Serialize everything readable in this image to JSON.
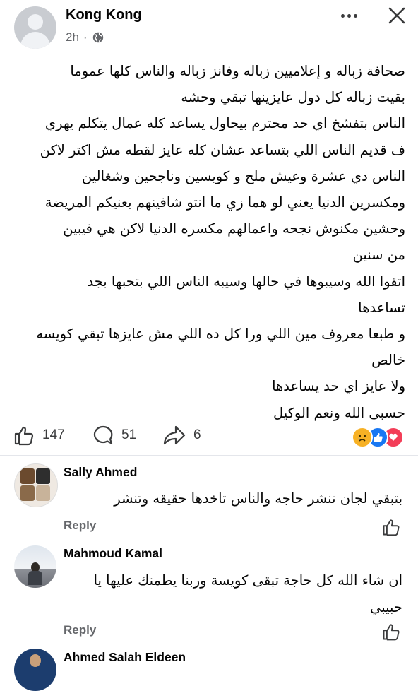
{
  "post": {
    "author": "Kong Kong",
    "time": "2h",
    "body_lines": [
      "صحافة زباله و إعلاميين زباله وفانز زباله والناس كلها عموما",
      "بقيت زباله كل دول عايزينها تبقي وحشه",
      "الناس بتفشخ اي حد محترم بيحاول يساعد كله عمال يتكلم يهري",
      "ف قديم الناس اللي بتساعد عشان كله عايز لقطه مش اكتر لاكن",
      "الناس دي عشرة وعيش ملح و كويسين وناجحين وشغالين",
      "ومكسرين الدنيا يعني لو هما زي ما انتو شافينهم  بعنيكم المريضة",
      "وحشين مكنوش نجحه واعمالهم مكسره الدنيا لاكن هي فيبين",
      "من سنين",
      "اتقوا الله وسيبوها في حالها وسيبه الناس اللي بتحبها بجد",
      "تساعدها",
      "و طبعا معروف مين اللي ورا كل ده اللي مش عايزها تبقي كويسه",
      "خالص",
      "ولا عايز اي حد يساعدها",
      "حسبى الله ونعم الوكيل"
    ],
    "likes": "147",
    "comments": "51",
    "shares": "6"
  },
  "comments": [
    {
      "name": "Sally Ahmed",
      "lines": [
        "بتبقي لجان تنشر حاجه والناس تاخدها حقيقه وتنشر"
      ],
      "reply": "Reply"
    },
    {
      "name": "Mahmoud Kamal",
      "lines": [
        "ان شاء الله كل حاجة تبقى كويسة وربنا يطمنك عليها يا",
        "حبيبي"
      ],
      "reply": "Reply"
    },
    {
      "name": "Ahmed Salah Eldeen",
      "lines": [],
      "reply": ""
    }
  ],
  "colors": {
    "like_blue": "#1877f2",
    "love_red": "#f33e58",
    "haha_yellow": "#f7b125",
    "muted_text": "#65676b"
  },
  "icons": {
    "more": "more-horizontal-icon",
    "close": "close-icon",
    "privacy": "globe-icon",
    "like": "thumbs-up-icon",
    "comment": "comment-bubble-icon",
    "share": "share-arrow-icon",
    "reactions": [
      "sad-reaction-icon",
      "like-reaction-icon",
      "love-reaction-icon"
    ]
  }
}
